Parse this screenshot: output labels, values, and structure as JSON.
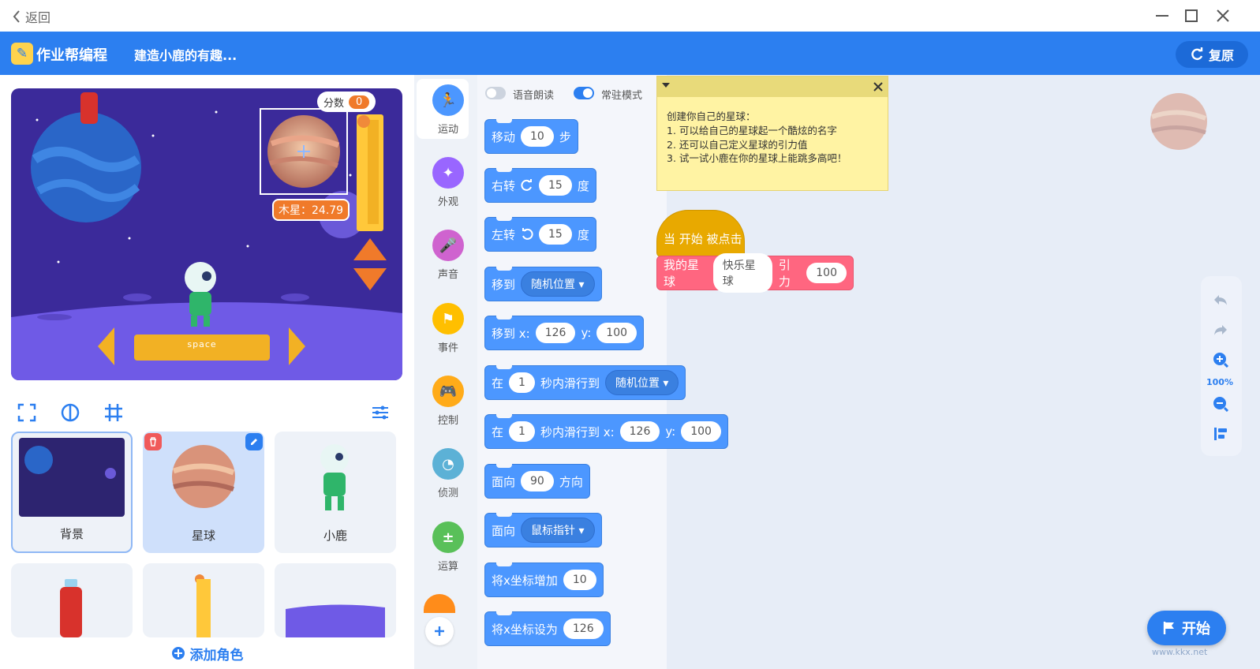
{
  "window": {
    "back_label": "返回"
  },
  "header": {
    "brand": "作业帮编程",
    "project_title": "建造小鹿的有趣...",
    "restore_label": "复原"
  },
  "stage": {
    "score_label": "分数",
    "score_value": "0",
    "planet_label": "木星：24.79",
    "space_label": "space"
  },
  "sprites": [
    {
      "name": "背景"
    },
    {
      "name": "星球"
    },
    {
      "name": "小鹿"
    },
    {
      "name": ""
    },
    {
      "name": ""
    },
    {
      "name": ""
    }
  ],
  "add_role_label": "添加角色",
  "categories": [
    {
      "label": "运动",
      "color": "#4c97ff"
    },
    {
      "label": "外观",
      "color": "#9966ff"
    },
    {
      "label": "声音",
      "color": "#cf63cf"
    },
    {
      "label": "事件",
      "color": "#ffbf00"
    },
    {
      "label": "控制",
      "color": "#ffab19"
    },
    {
      "label": "侦测",
      "color": "#5cb1d6"
    },
    {
      "label": "运算",
      "color": "#59c059"
    }
  ],
  "palette": {
    "voice_read_label": "语音朗读",
    "resident_mode_label": "常驻模式",
    "blocks": {
      "move_label": "移动",
      "move_value": "10",
      "move_unit": "步",
      "turn_right_label": "右转",
      "turn_right_value": "15",
      "turn_right_unit": "度",
      "turn_left_label": "左转",
      "turn_left_value": "15",
      "turn_left_unit": "度",
      "goto_label": "移到",
      "goto_option": "随机位置",
      "gotoxy_label": "移到 x:",
      "gotoxy_x": "126",
      "gotoxy_y_label": "y:",
      "gotoxy_y": "100",
      "glide_label": "在",
      "glide_value": "1",
      "glide_mid": "秒内滑行到",
      "glide_option": "随机位置",
      "glidexy_label": "在",
      "glidexy_value": "1",
      "glidexy_mid": "秒内滑行到 x:",
      "glidexy_x": "126",
      "glidexy_y_label": "y:",
      "glidexy_y": "100",
      "point_label": "面向",
      "point_value": "90",
      "point_unit": "方向",
      "pointto_label": "面向",
      "pointto_option": "鼠标指针",
      "changex_label": "将x坐标增加",
      "changex_value": "10",
      "setx_label": "将x坐标设为",
      "setx_value": "126"
    }
  },
  "note": {
    "lines": [
      "创建你自己的星球：",
      "1. 可以给自己的星球起一个酷炫的名字",
      "2. 还可以自己定义星球的引力值",
      "3. 试一试小鹿在你的星球上能跳多高吧！"
    ]
  },
  "workspace": {
    "hat_label": "当 开始 被点击",
    "planet_block_label": "我的星球",
    "planet_name": "快乐星球",
    "gravity_label": "引力",
    "gravity_value": "100",
    "zoom_label": "100%"
  },
  "start_label": "开始",
  "watermark": "www.kkx.net"
}
